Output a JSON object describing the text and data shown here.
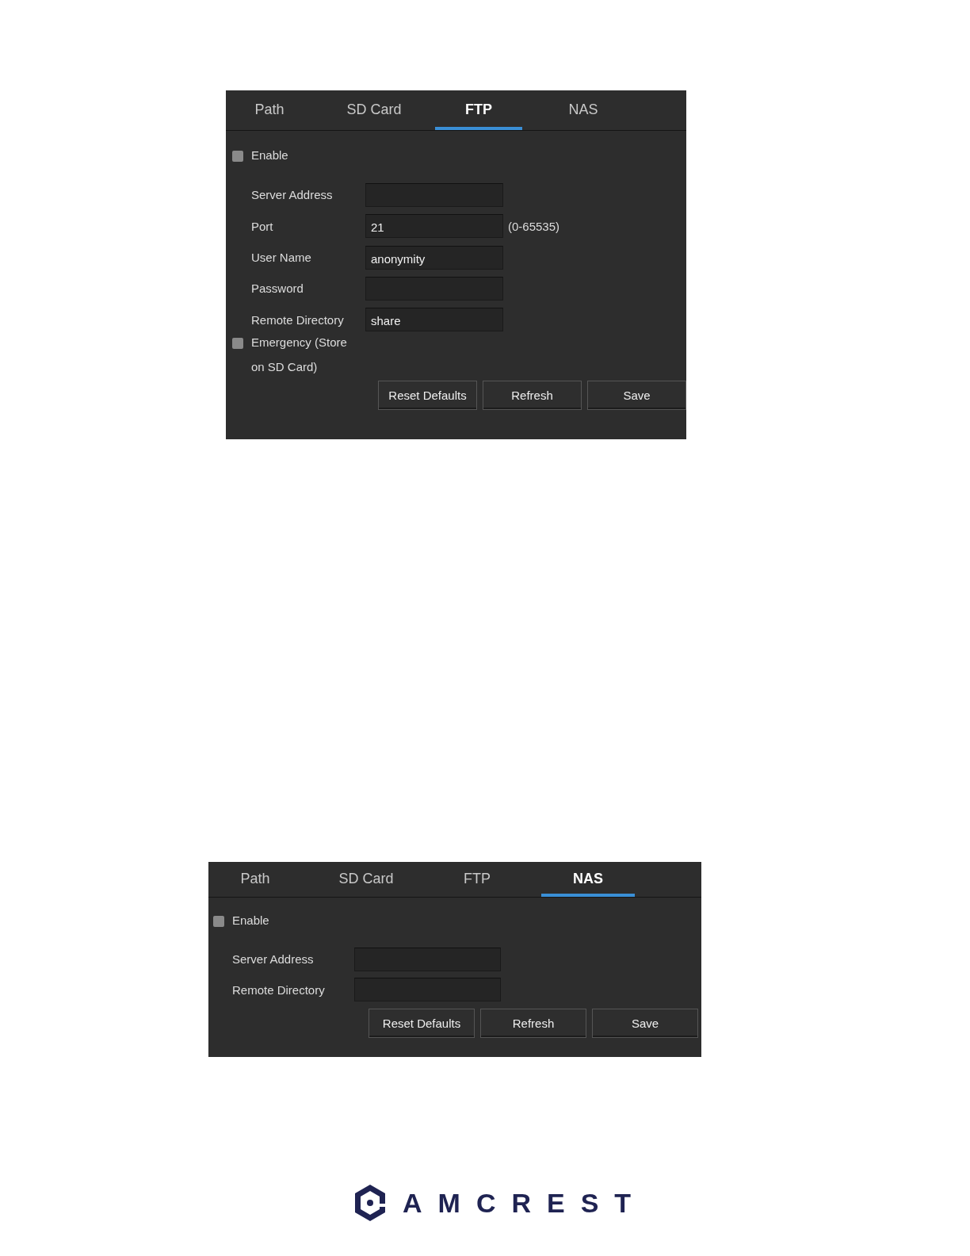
{
  "panels": [
    {
      "tabs": [
        {
          "label": "Path",
          "selected": false
        },
        {
          "label": "SD Card",
          "selected": false
        },
        {
          "label": "FTP",
          "selected": true
        },
        {
          "label": "NAS",
          "selected": false
        }
      ],
      "rows": [
        {
          "kind": "checkbox",
          "label": "Enable",
          "checked": false
        },
        {
          "kind": "field",
          "label": "Server Address"
        },
        {
          "kind": "field",
          "label": "Port",
          "value": "21",
          "hint": "(0-65535)"
        },
        {
          "kind": "field",
          "label": "User Name",
          "value": "anonymity"
        },
        {
          "kind": "field",
          "label": "Password"
        },
        {
          "kind": "field",
          "label": "Remote Directory",
          "value": "share"
        },
        {
          "kind": "checkbox",
          "label": "Emergency (Store on SD Card)",
          "checked": false
        }
      ],
      "buttons": [
        "Reset Defaults",
        "Refresh",
        "Save"
      ]
    },
    {
      "tabs": [
        {
          "label": "Path",
          "selected": false
        },
        {
          "label": "SD Card",
          "selected": false
        },
        {
          "label": "FTP",
          "selected": false
        },
        {
          "label": "NAS",
          "selected": true
        }
      ],
      "rows": [
        {
          "kind": "checkbox",
          "label": "Enable",
          "checked": false
        },
        {
          "kind": "field",
          "label": "Server Address"
        },
        {
          "kind": "field",
          "label": "Remote Directory"
        }
      ],
      "buttons": [
        "Reset Defaults",
        "Refresh",
        "Save"
      ]
    }
  ],
  "logo": {
    "text": "AMCREST"
  }
}
